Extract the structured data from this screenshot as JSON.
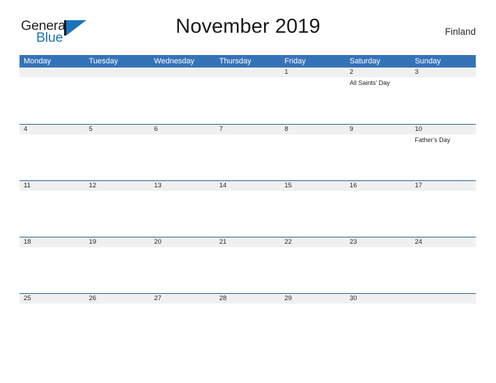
{
  "brand": {
    "word_one": "General",
    "word_two": "Blue",
    "accent_color": "#1b74ba"
  },
  "header": {
    "title": "November 2019",
    "country": "Finland"
  },
  "theme": {
    "header_blue": "#3573b9",
    "rule_blue": "#2b5f96",
    "strip_gray": "#f0f0f0"
  },
  "calendar": {
    "weekdays": [
      "Monday",
      "Tuesday",
      "Wednesday",
      "Thursday",
      "Friday",
      "Saturday",
      "Sunday"
    ],
    "weeks": [
      {
        "days": [
          {
            "num": "",
            "event": ""
          },
          {
            "num": "",
            "event": ""
          },
          {
            "num": "",
            "event": ""
          },
          {
            "num": "",
            "event": ""
          },
          {
            "num": "1",
            "event": ""
          },
          {
            "num": "2",
            "event": "All Saints' Day"
          },
          {
            "num": "3",
            "event": ""
          }
        ]
      },
      {
        "days": [
          {
            "num": "4",
            "event": ""
          },
          {
            "num": "5",
            "event": ""
          },
          {
            "num": "6",
            "event": ""
          },
          {
            "num": "7",
            "event": ""
          },
          {
            "num": "8",
            "event": ""
          },
          {
            "num": "9",
            "event": ""
          },
          {
            "num": "10",
            "event": "Father's Day"
          }
        ]
      },
      {
        "days": [
          {
            "num": "11",
            "event": ""
          },
          {
            "num": "12",
            "event": ""
          },
          {
            "num": "13",
            "event": ""
          },
          {
            "num": "14",
            "event": ""
          },
          {
            "num": "15",
            "event": ""
          },
          {
            "num": "16",
            "event": ""
          },
          {
            "num": "17",
            "event": ""
          }
        ]
      },
      {
        "days": [
          {
            "num": "18",
            "event": ""
          },
          {
            "num": "19",
            "event": ""
          },
          {
            "num": "20",
            "event": ""
          },
          {
            "num": "21",
            "event": ""
          },
          {
            "num": "22",
            "event": ""
          },
          {
            "num": "23",
            "event": ""
          },
          {
            "num": "24",
            "event": ""
          }
        ]
      },
      {
        "days": [
          {
            "num": "25",
            "event": ""
          },
          {
            "num": "26",
            "event": ""
          },
          {
            "num": "27",
            "event": ""
          },
          {
            "num": "28",
            "event": ""
          },
          {
            "num": "29",
            "event": ""
          },
          {
            "num": "30",
            "event": ""
          },
          {
            "num": "",
            "event": ""
          }
        ]
      }
    ]
  }
}
